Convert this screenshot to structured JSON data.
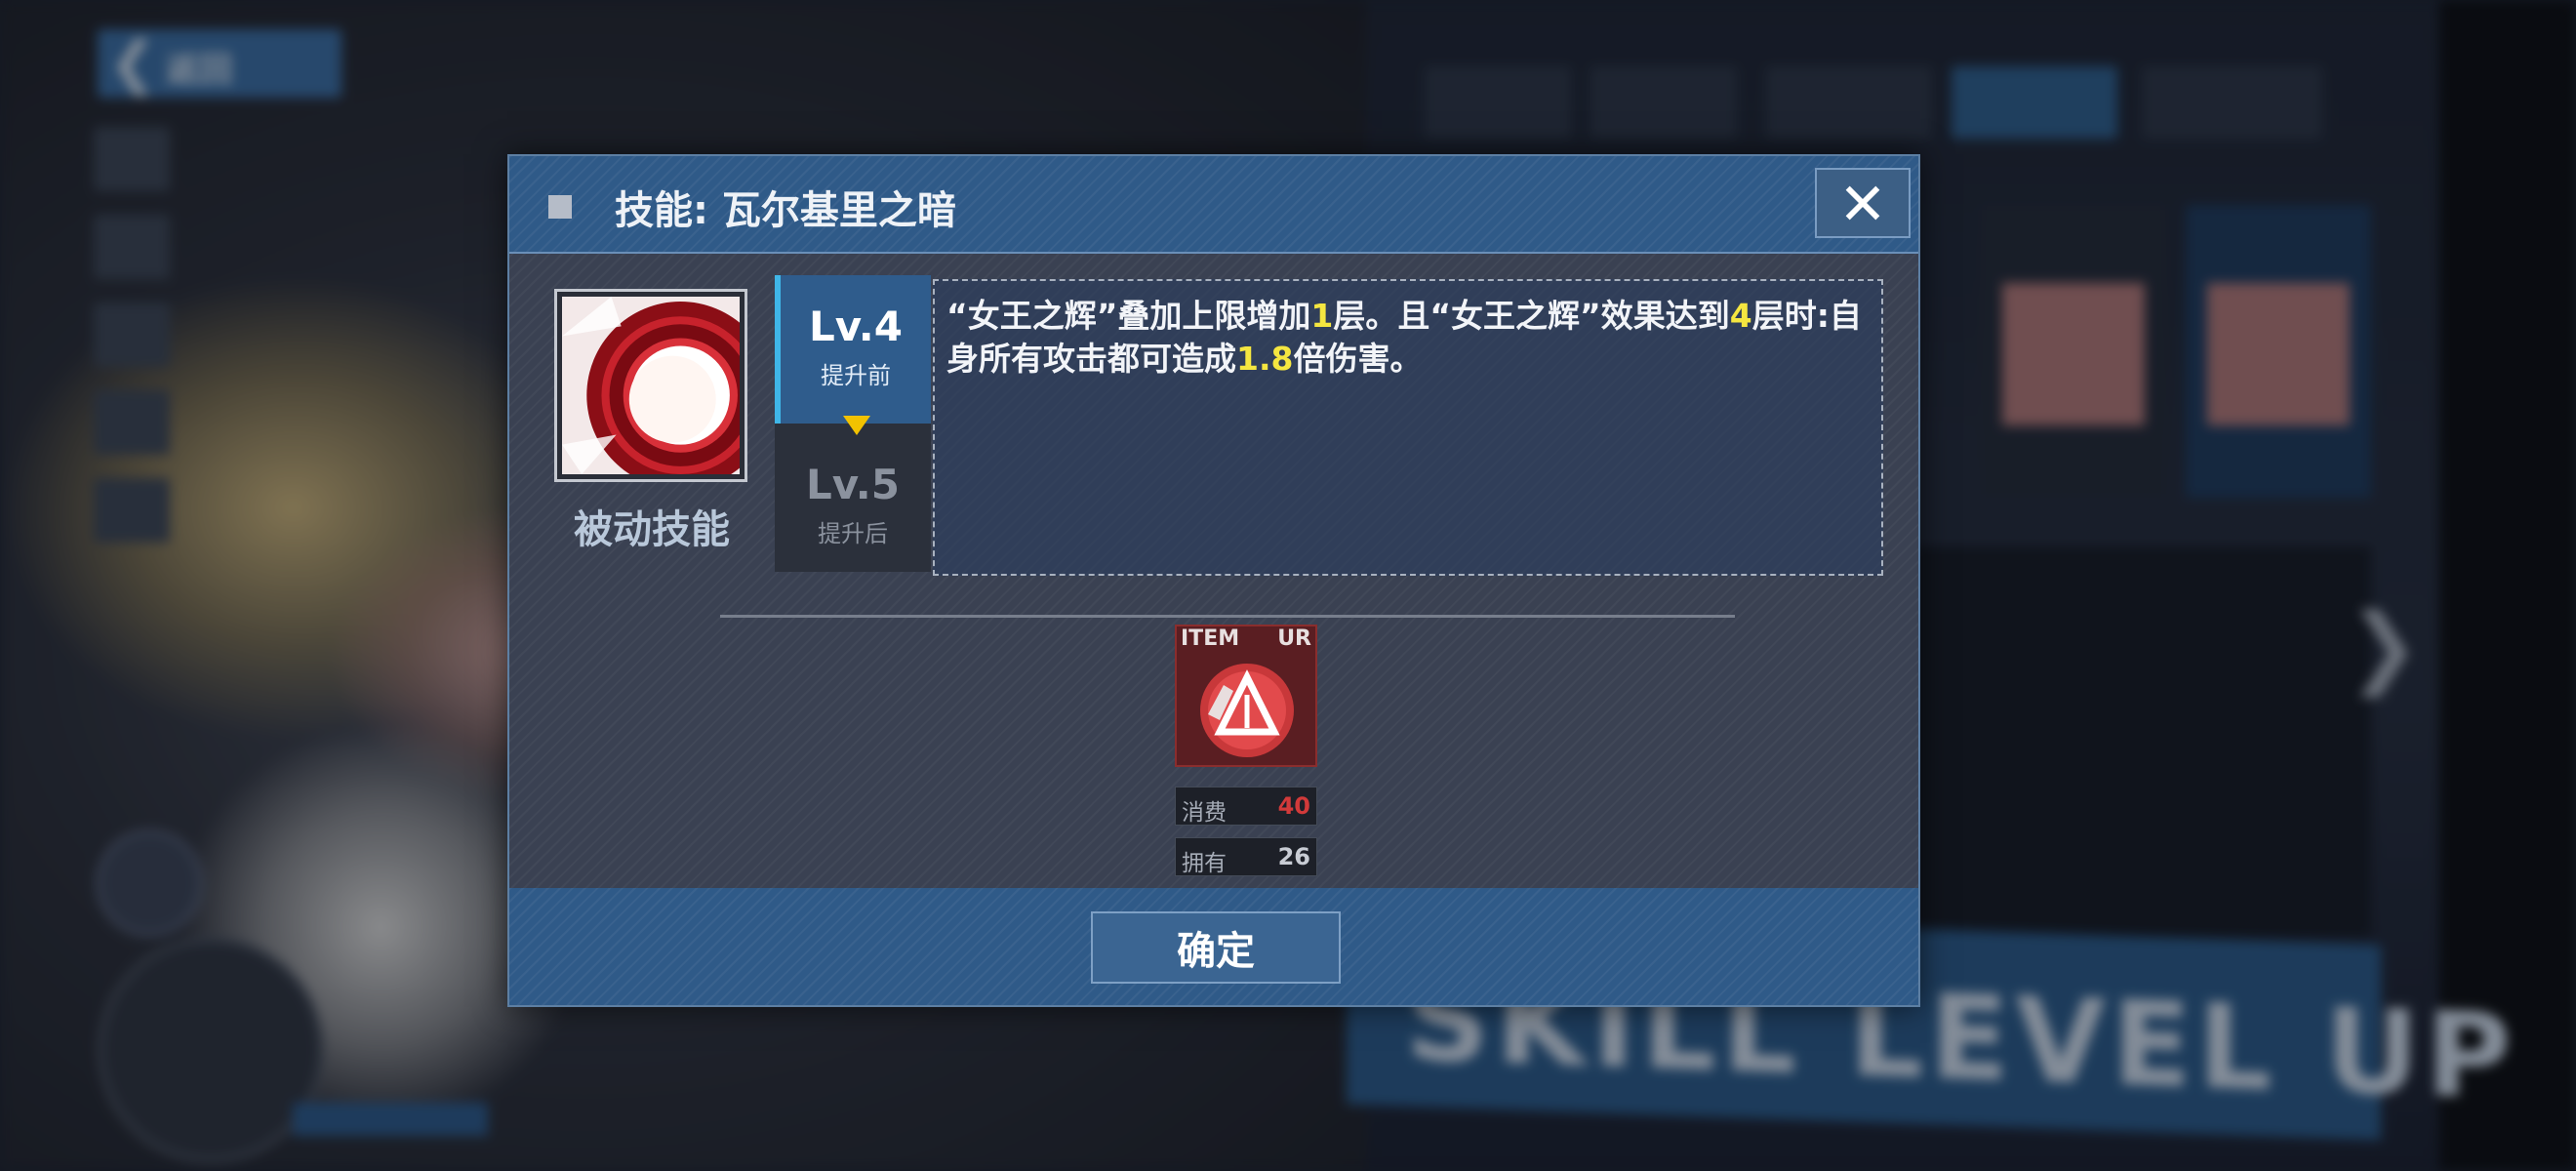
{
  "background": {
    "back_label": "返回",
    "banner_text": "SKILL LEVEL UP"
  },
  "dialog": {
    "title": "技能:  瓦尔基里之暗",
    "close_label": "X",
    "skill_type": "被动技能",
    "current_level": {
      "label": "Lv.4",
      "sub": "提升前"
    },
    "next_level": {
      "label": "Lv.5",
      "sub": "提升后"
    },
    "description": {
      "p1": "“女王之辉”叠加上限增加",
      "v1": "1",
      "p2": "层。且“女王之辉”效果达到",
      "v2": "4",
      "p3": "层时:自身所有攻击都可造成",
      "v3": "1.8",
      "p4": "倍伤害。"
    },
    "item": {
      "tag": "ITEM",
      "rarity": "UR"
    },
    "cost": {
      "label": "消费",
      "value": "40"
    },
    "owned": {
      "label": "拥有",
      "value": "26"
    },
    "confirm_label": "确定"
  },
  "colors": {
    "accent": "#2f5a88",
    "highlight": "#f5e640",
    "cost_red": "#d23a3a",
    "level_marker": "#f2c200"
  }
}
